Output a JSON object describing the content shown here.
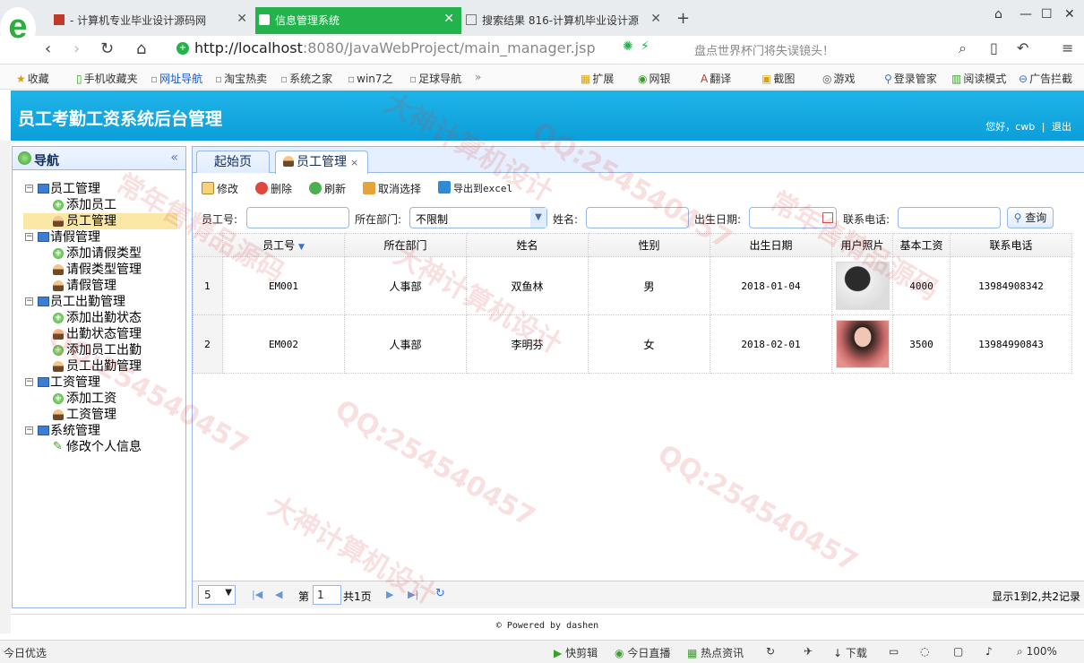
{
  "browser": {
    "tabs": [
      {
        "label": "- 计算机专业毕业设计源码网",
        "active": false
      },
      {
        "label": "信息管理系统",
        "active": true
      },
      {
        "label": "搜索结果 816-计算机毕业设计源",
        "active": false
      }
    ],
    "new_tab": "+",
    "url_host": "http://localhost",
    "url_path": ":8080/JavaWebProject/main_manager.jsp",
    "search_placeholder": "盘点世界杯门将失误镜头！",
    "bookmarks": [
      "收藏",
      "手机收藏夹",
      "网址导航",
      "淘宝热卖",
      "系统之家",
      "win7之",
      "足球导航"
    ],
    "toolbar_items": [
      "扩展",
      "网银",
      "翻译",
      "截图",
      "游戏",
      "登录管家",
      "阅读模式",
      "广告拦截"
    ]
  },
  "app": {
    "title": "员工考勤工资系统后台管理",
    "greeting": "您好，cwb",
    "separator": "|",
    "logout": "退出"
  },
  "sidebar": {
    "title": "导航",
    "groups": [
      {
        "label": "员工管理",
        "items": [
          "添加员工",
          "员工管理"
        ]
      },
      {
        "label": "请假管理",
        "items": [
          "添加请假类型",
          "请假类型管理",
          "请假管理"
        ]
      },
      {
        "label": "员工出勤管理",
        "items": [
          "添加出勤状态",
          "出勤状态管理",
          "添加员工出勤",
          "员工出勤管理"
        ]
      },
      {
        "label": "工资管理",
        "items": [
          "添加工资",
          "工资管理"
        ]
      },
      {
        "label": "系统管理",
        "items": [
          "修改个人信息"
        ]
      }
    ],
    "selected": "员工管理"
  },
  "main": {
    "tabs": [
      "起始页",
      "员工管理"
    ],
    "toolbar": {
      "edit": "修改",
      "delete": "删除",
      "refresh": "刷新",
      "cancel": "取消选择",
      "export": "导出到excel"
    },
    "search": {
      "emp_no_label": "员工号:",
      "dept_label": "所在部门:",
      "dept_value": "不限制",
      "name_label": "姓名:",
      "birth_label": "出生日期:",
      "phone_label": "联系电话:",
      "query_button": "查询"
    },
    "grid": {
      "columns": [
        "员工号",
        "所在部门",
        "姓名",
        "性别",
        "出生日期",
        "用户照片",
        "基本工资",
        "联系电话"
      ],
      "rows": [
        {
          "rownum": "1",
          "emp_no": "EM001",
          "dept": "人事部",
          "name": "双鱼林",
          "sex": "男",
          "birth": "2018-01-04",
          "salary": "4000",
          "phone": "13984908342"
        },
        {
          "rownum": "2",
          "emp_no": "EM002",
          "dept": "人事部",
          "name": "李明芬",
          "sex": "女",
          "birth": "2018-02-01",
          "salary": "3500",
          "phone": "13984990843"
        }
      ]
    },
    "pager": {
      "page_size": "5",
      "page_prefix": "第",
      "page_value": "1",
      "page_total": "共1页",
      "info": "显示1到2,共2记录"
    }
  },
  "footer": "© Powered by dashen",
  "statusbar": {
    "left": "今日优选",
    "items": [
      "快剪辑",
      "今日直播",
      "热点资讯",
      "下载"
    ],
    "zoom": "100%"
  },
  "watermark": [
    "大神计算机设计",
    "QQ:254540457",
    "常年售精品源码"
  ]
}
